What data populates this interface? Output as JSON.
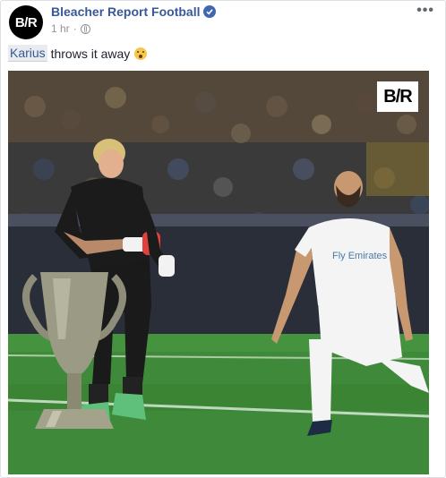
{
  "post": {
    "page_name": "Bleacher Report Football",
    "avatar_text": "B/R",
    "time": "1 hr",
    "dot": "·",
    "more_icon": "more-horizontal-icon",
    "caption_tag": "Karius",
    "caption_rest": "throws it away",
    "caption_emoji": "flushed-face-emoji",
    "photo_watermark": "B/R",
    "jersey_text": "Fly Emirates",
    "colors": {
      "link": "#385898",
      "verified": "#4267b2",
      "meta": "#90949c",
      "pitch": "#3f8a3a"
    }
  }
}
